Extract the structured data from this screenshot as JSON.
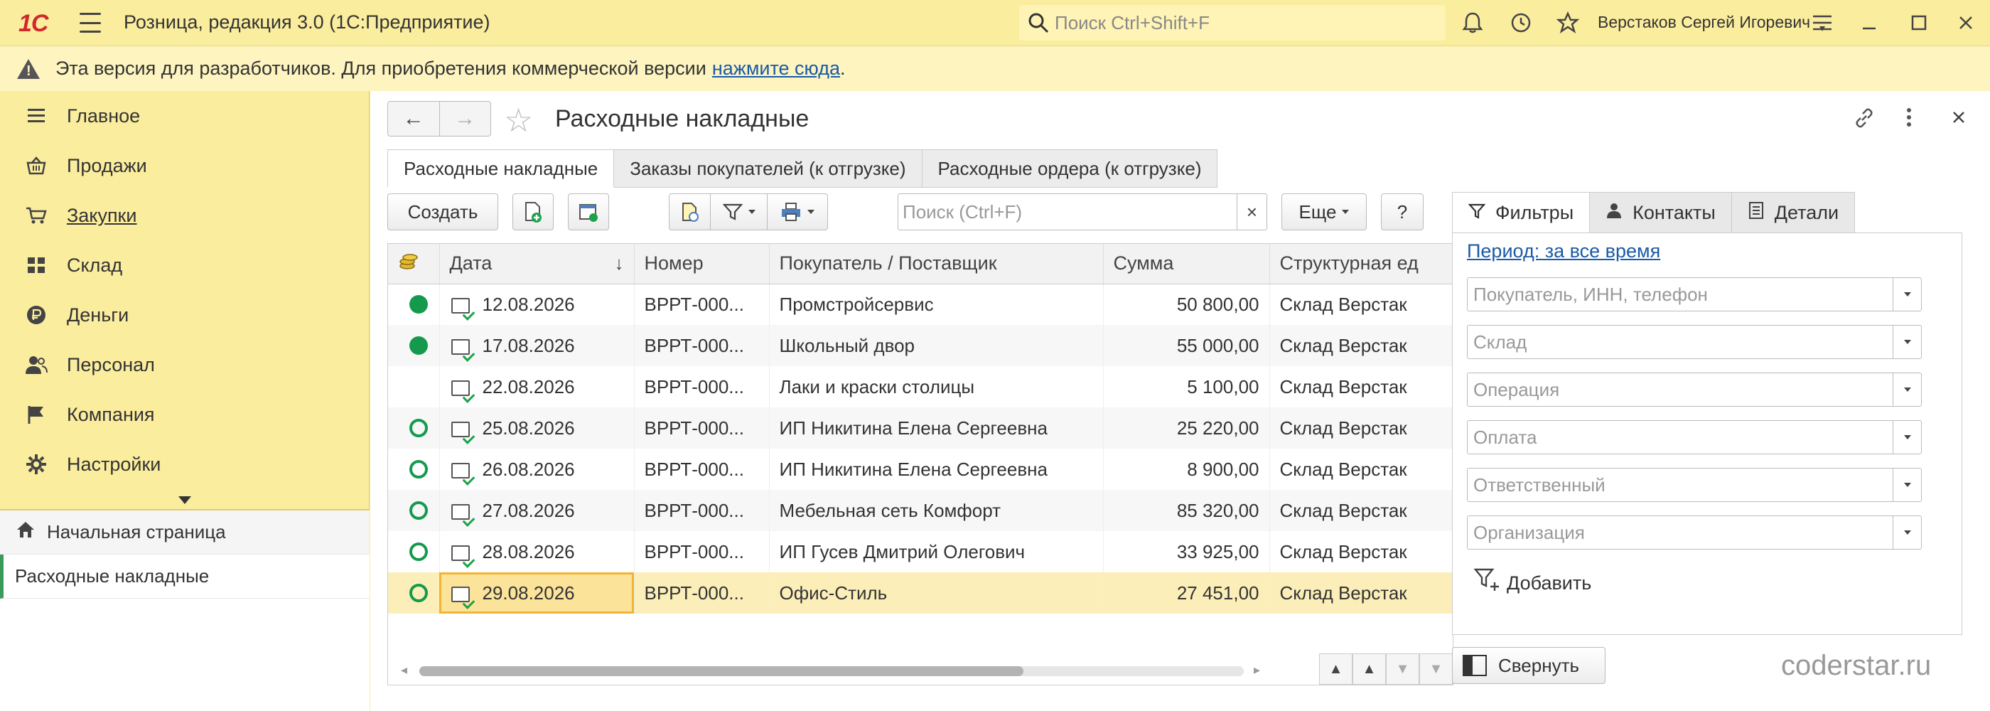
{
  "titlebar": {
    "logo": "1С",
    "app_title": "Розница, редакция 3.0  (1С:Предприятие)",
    "search_placeholder": "Поиск Ctrl+Shift+F",
    "user_name": "Верстаков Сергей Игоревич"
  },
  "notice": {
    "text": "Эта версия для разработчиков. Для приобретения коммерческой версии",
    "link": "нажмите сюда",
    "tail": "."
  },
  "sidebar": {
    "items": [
      {
        "label": "Главное",
        "icon": "menu-lines-icon"
      },
      {
        "label": "Продажи",
        "icon": "basket-icon"
      },
      {
        "label": "Закупки",
        "icon": "cart-icon"
      },
      {
        "label": "Склад",
        "icon": "warehouse-grid-icon"
      },
      {
        "label": "Деньги",
        "icon": "ruble-coin-icon"
      },
      {
        "label": "Персонал",
        "icon": "people-icon"
      },
      {
        "label": "Компания",
        "icon": "flag-icon"
      },
      {
        "label": "Настройки",
        "icon": "gear-icon"
      }
    ],
    "open_windows": {
      "home": "Начальная страница",
      "active": "Расходные накладные"
    }
  },
  "content": {
    "title": "Расходные накладные",
    "tabs": [
      "Расходные накладные",
      "Заказы покупателей (к отгрузке)",
      "Расходные ордера (к отгрузке)"
    ],
    "toolbar": {
      "create_label": "Создать",
      "search_placeholder": "Поиск (Ctrl+F)",
      "clear": "×",
      "more_label": "Еще",
      "help_label": "?"
    },
    "columns": [
      "Дата",
      "Номер",
      "Покупатель / Поставщик",
      "Сумма",
      "Структурная ед"
    ],
    "rows": [
      {
        "status": "full",
        "date": "12.08.2026",
        "number": "ВРРТ-000...",
        "partner": "Промстройсервис",
        "sum": "50 800,00",
        "unit": "Склад Верстак"
      },
      {
        "status": "full",
        "date": "17.08.2026",
        "number": "ВРРТ-000...",
        "partner": "Школьный двор",
        "sum": "55 000,00",
        "unit": "Склад Верстак"
      },
      {
        "status": "none",
        "date": "22.08.2026",
        "number": "ВРРТ-000...",
        "partner": "Лаки и краски столицы",
        "sum": "5 100,00",
        "unit": "Склад Верстак"
      },
      {
        "status": "ring",
        "date": "25.08.2026",
        "number": "ВРРТ-000...",
        "partner": "ИП Никитина Елена Сергеевна",
        "sum": "25 220,00",
        "unit": "Склад Верстак"
      },
      {
        "status": "ring",
        "date": "26.08.2026",
        "number": "ВРРТ-000...",
        "partner": "ИП Никитина Елена Сергеевна",
        "sum": "8 900,00",
        "unit": "Склад Верстак"
      },
      {
        "status": "ring",
        "date": "27.08.2026",
        "number": "ВРРТ-000...",
        "partner": "Мебельная сеть Комфорт",
        "sum": "85 320,00",
        "unit": "Склад Верстак"
      },
      {
        "status": "ring",
        "date": "28.08.2026",
        "number": "ВРРТ-000...",
        "partner": "ИП Гусев Дмитрий Олегович",
        "sum": "33 925,00",
        "unit": "Склад Верстак"
      },
      {
        "status": "ring",
        "date": "29.08.2026",
        "number": "ВРРТ-000...",
        "partner": "Офис-Стиль",
        "sum": "27 451,00",
        "unit": "Склад Верстак"
      }
    ]
  },
  "filters": {
    "tabs": [
      "Фильтры",
      "Контакты",
      "Детали"
    ],
    "period_link": "Период: за все время",
    "fields": [
      "Покупатель, ИНН, телефон",
      "Склад",
      "Операция",
      "Оплата",
      "Ответственный",
      "Организация"
    ],
    "add_label": "Добавить",
    "collapse_label": "Свернуть"
  },
  "watermark": "coderstar.ru",
  "colors": {
    "accent_yellow": "#fbed9e",
    "status_green": "#159a4d",
    "link_blue": "#1a5aa8",
    "selection": "#fbeeb8"
  }
}
